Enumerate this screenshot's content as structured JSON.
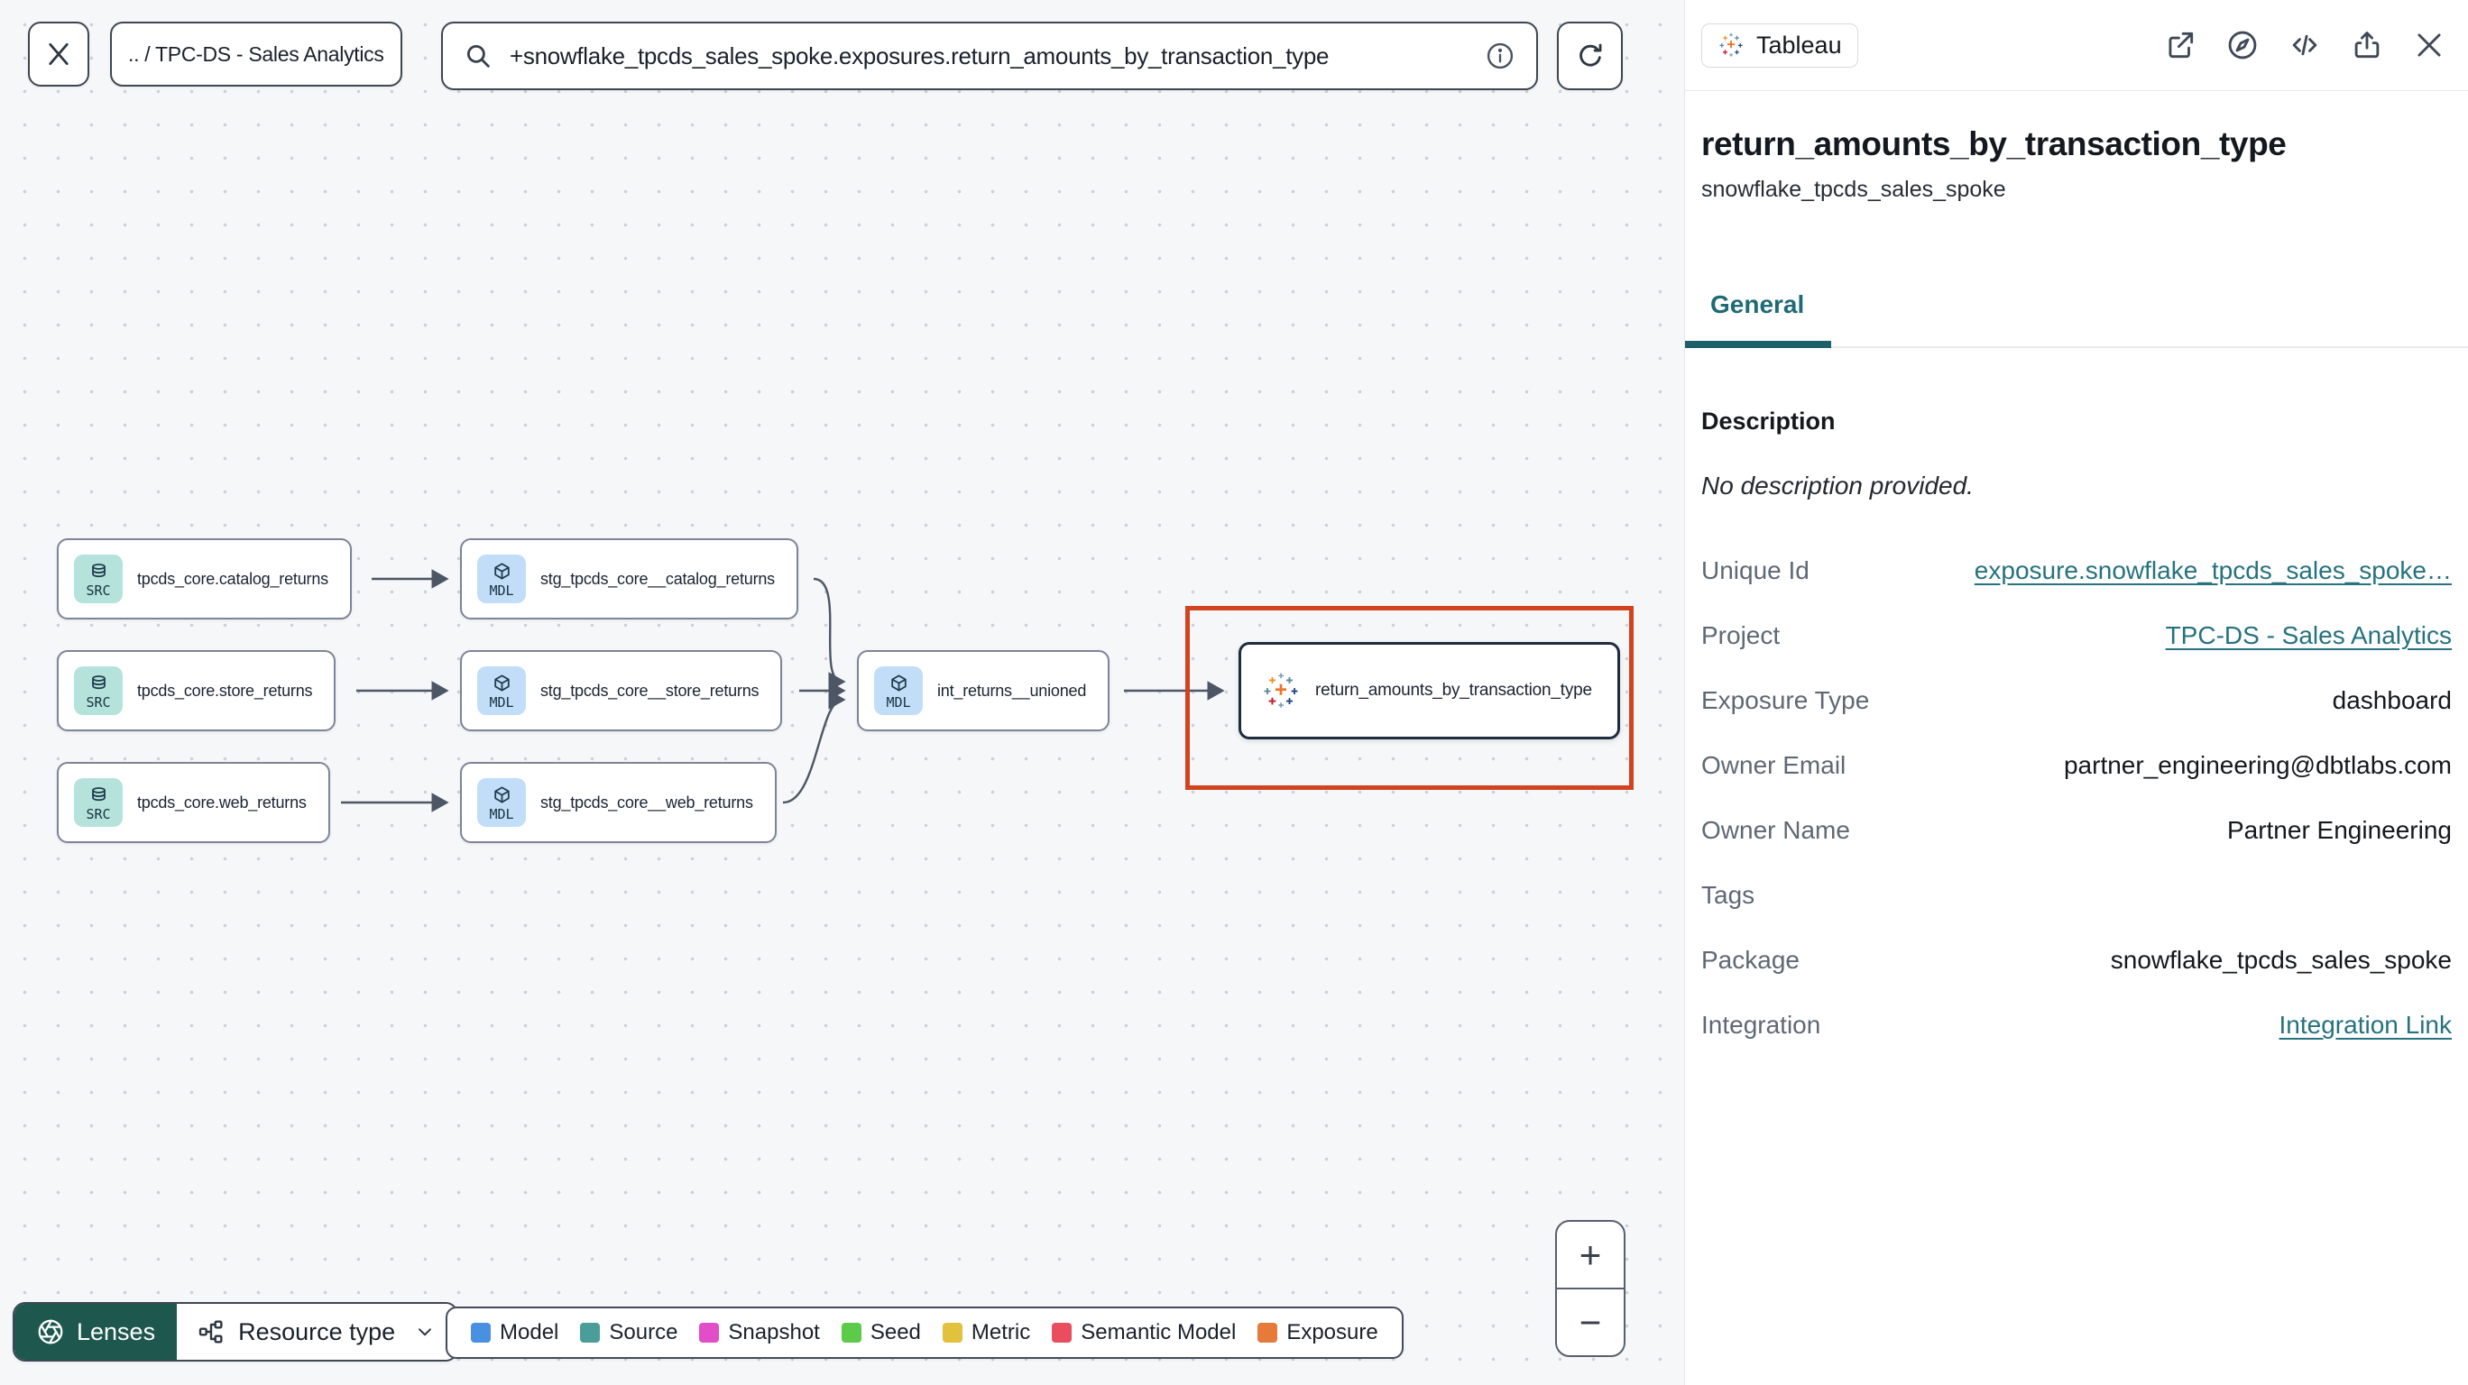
{
  "toolbar": {
    "breadcrumb": ".. / TPC-DS - Sales Analytics",
    "search_value": "+snowflake_tpcds_sales_spoke.exposures.return_amounts_by_transaction_type"
  },
  "panel": {
    "badge": "Tableau",
    "title": "return_amounts_by_transaction_type",
    "subtitle": "snowflake_tpcds_sales_spoke",
    "tab": "General",
    "description_label": "Description",
    "description_value": "No description provided.",
    "fields": [
      {
        "label": "Unique Id",
        "value": "exposure.snowflake_tpcds_sales_spoke…",
        "link": true
      },
      {
        "label": "Project",
        "value": "TPC-DS - Sales Analytics",
        "link": true
      },
      {
        "label": "Exposure Type",
        "value": "dashboard",
        "link": false
      },
      {
        "label": "Owner Email",
        "value": "partner_engineering@dbtlabs.com",
        "link": false
      },
      {
        "label": "Owner Name",
        "value": "Partner Engineering",
        "link": false
      },
      {
        "label": "Tags",
        "value": "",
        "link": false
      },
      {
        "label": "Package",
        "value": "snowflake_tpcds_sales_spoke",
        "link": false
      },
      {
        "label": "Integration",
        "value": "Integration Link",
        "link": true
      }
    ]
  },
  "graph": {
    "nodes": [
      {
        "label": "tpcds_core.catalog_returns",
        "badge": "SRC",
        "type": "source"
      },
      {
        "label": "tpcds_core.store_returns",
        "badge": "SRC",
        "type": "source"
      },
      {
        "label": "tpcds_core.web_returns",
        "badge": "SRC",
        "type": "source"
      },
      {
        "label": "stg_tpcds_core__catalog_returns",
        "badge": "MDL",
        "type": "model"
      },
      {
        "label": "stg_tpcds_core__store_returns",
        "badge": "MDL",
        "type": "model"
      },
      {
        "label": "stg_tpcds_core__web_returns",
        "badge": "MDL",
        "type": "model"
      },
      {
        "label": "int_returns__unioned",
        "badge": "MDL",
        "type": "model"
      },
      {
        "label": "return_amounts_by_transaction_type",
        "type": "exposure"
      }
    ],
    "highlight_color": "#d24320"
  },
  "legend": {
    "items": [
      {
        "label": "Model",
        "color": "#4a90e2"
      },
      {
        "label": "Source",
        "color": "#4a9d98"
      },
      {
        "label": "Snapshot",
        "color": "#e14ec8"
      },
      {
        "label": "Seed",
        "color": "#5dcb4a"
      },
      {
        "label": "Metric",
        "color": "#e2c23c"
      },
      {
        "label": "Semantic Model",
        "color": "#ea4e5e"
      },
      {
        "label": "Exposure",
        "color": "#e57a3a"
      }
    ]
  },
  "controls": {
    "lenses_label": "Lenses",
    "lenses_bg": "#1d574d",
    "resource_type_label": "Resource type",
    "zoom_in": "+",
    "zoom_out": "−"
  },
  "colors": {
    "accent_teal": "#1d6069",
    "link_teal": "#26727e"
  }
}
